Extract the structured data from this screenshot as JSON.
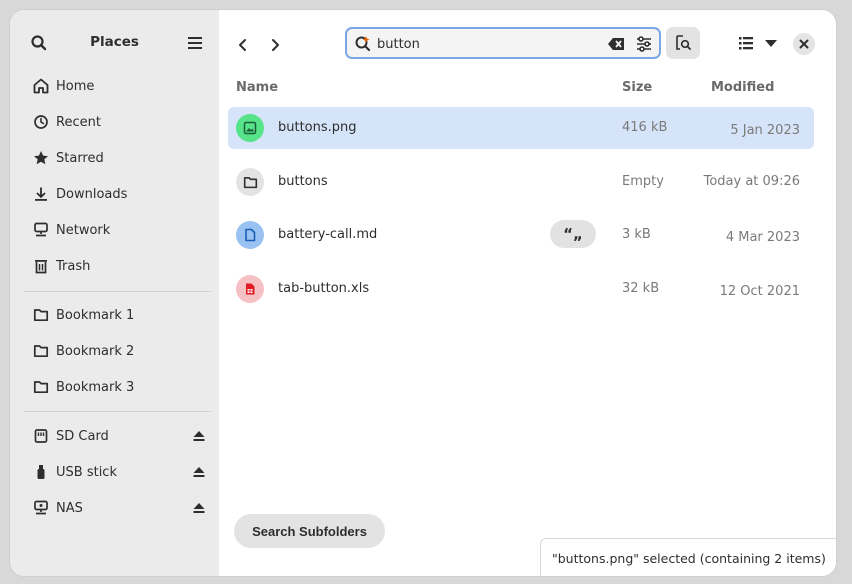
{
  "sidebar": {
    "title": "Places",
    "places": [
      {
        "label": "Home",
        "icon": "home-icon"
      },
      {
        "label": "Recent",
        "icon": "clock-icon"
      },
      {
        "label": "Starred",
        "icon": "star-icon"
      },
      {
        "label": "Downloads",
        "icon": "download-icon"
      },
      {
        "label": "Network",
        "icon": "network-icon"
      },
      {
        "label": "Trash",
        "icon": "trash-icon"
      }
    ],
    "bookmarks": [
      {
        "label": "Bookmark 1",
        "icon": "folder-icon"
      },
      {
        "label": "Bookmark 2",
        "icon": "folder-icon"
      },
      {
        "label": "Bookmark 3",
        "icon": "folder-icon"
      }
    ],
    "devices": [
      {
        "label": "SD Card",
        "icon": "sd-card-icon"
      },
      {
        "label": "USB stick",
        "icon": "usb-icon"
      },
      {
        "label": "NAS",
        "icon": "nas-icon"
      }
    ]
  },
  "search": {
    "value": "button"
  },
  "columns": {
    "name": "Name",
    "size": "Size",
    "modified": "Modified"
  },
  "files": [
    {
      "name": "buttons.png",
      "size": "416 kB",
      "modified": "5 Jan 2023",
      "icon": "image-file-icon",
      "selected": true
    },
    {
      "name": "buttons",
      "size": "Empty",
      "modified": "Today at 09:26",
      "icon": "folder-icon",
      "selected": false
    },
    {
      "name": "battery-call.md",
      "size": "3 kB",
      "modified": "4 Mar 2023",
      "icon": "document-file-icon",
      "selected": false,
      "badge": "“„"
    },
    {
      "name": "tab-button.xls",
      "size": "32 kB",
      "modified": "12 Oct 2021",
      "icon": "spreadsheet-file-icon",
      "selected": false
    }
  ],
  "search_subfolders_label": "Search Subfolders",
  "status_text": "\"buttons.png\" selected (containing 2 items)",
  "colors": {
    "accent": "#3584e4",
    "selection": "#d5e4f8",
    "sidebar_bg": "#ebebeb"
  }
}
